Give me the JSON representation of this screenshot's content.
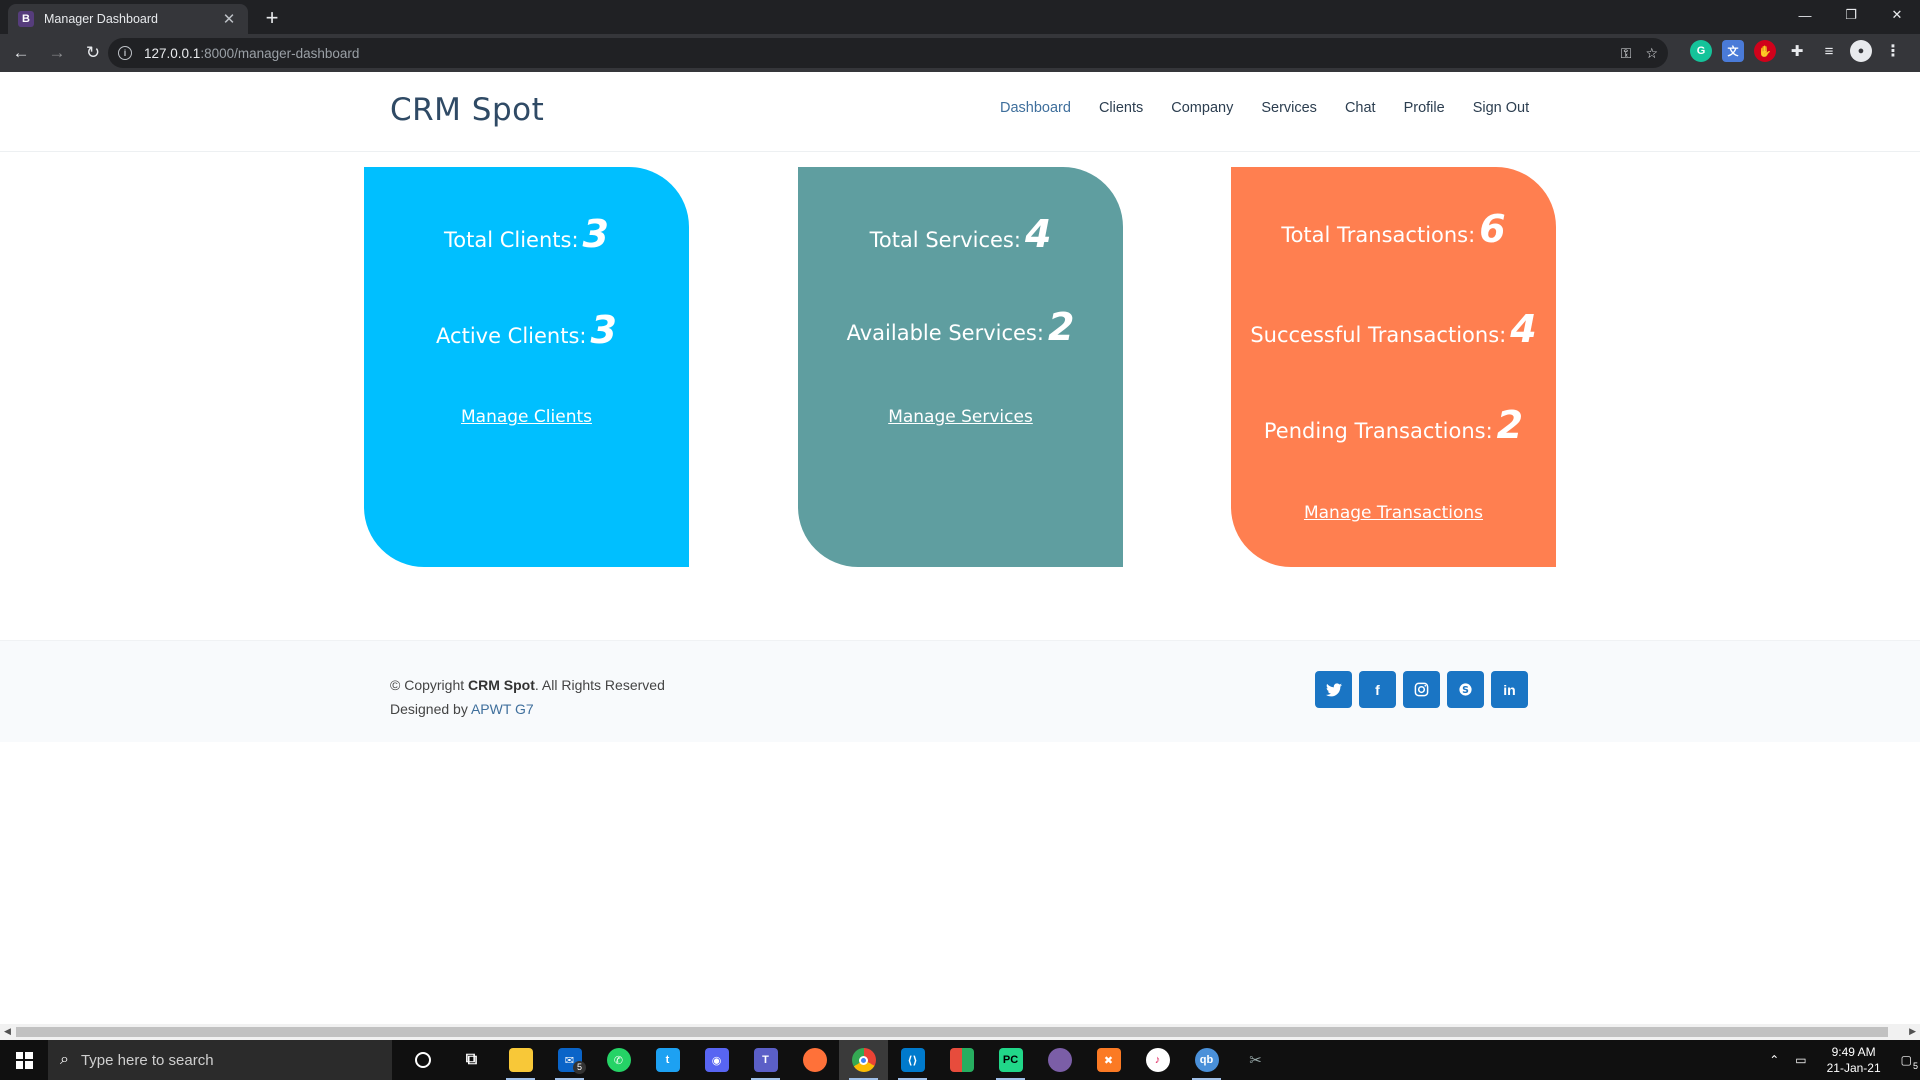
{
  "browser": {
    "tab_title": "Manager Dashboard",
    "tab_favicon": "B",
    "url_host": "127.0.0.1",
    "url_path": ":8000/manager-dashboard"
  },
  "site": {
    "logo": "CRM Spot",
    "nav": [
      {
        "label": "Dashboard",
        "active": true
      },
      {
        "label": "Clients"
      },
      {
        "label": "Company"
      },
      {
        "label": "Services"
      },
      {
        "label": "Chat"
      },
      {
        "label": "Profile"
      },
      {
        "label": "Sign Out"
      }
    ]
  },
  "cards": {
    "clients": {
      "total_label": "Total Clients:",
      "total_value": "3",
      "active_label": "Active Clients:",
      "active_value": "3",
      "link": "Manage Clients",
      "color": "#00bfff"
    },
    "services": {
      "total_label": "Total Services:",
      "total_value": "4",
      "available_label": "Available Services:",
      "available_value": "2",
      "link": "Manage Services",
      "color": "#5f9ea0"
    },
    "transactions": {
      "total_label": "Total Transactions:",
      "total_value": "6",
      "successful_label": "Successful Transactions:",
      "successful_value": "4",
      "pending_label": "Pending Transactions:",
      "pending_value": "2",
      "link": "Manage Transactions",
      "color": "#ff7f50"
    }
  },
  "footer": {
    "copyright_prefix": "© Copyright ",
    "brand": "CRM Spot",
    "copyright_suffix": ". All Rights Reserved",
    "designed_by": "Designed by ",
    "designer": "APWT G7",
    "socials": [
      "twitter-icon",
      "facebook-icon",
      "instagram-icon",
      "skype-icon",
      "linkedin-icon"
    ]
  },
  "taskbar": {
    "search_placeholder": "Type here to search",
    "time": "9:49 AM",
    "date": "21-Jan-21",
    "mail_badge": "5",
    "notification_badge": "5"
  }
}
